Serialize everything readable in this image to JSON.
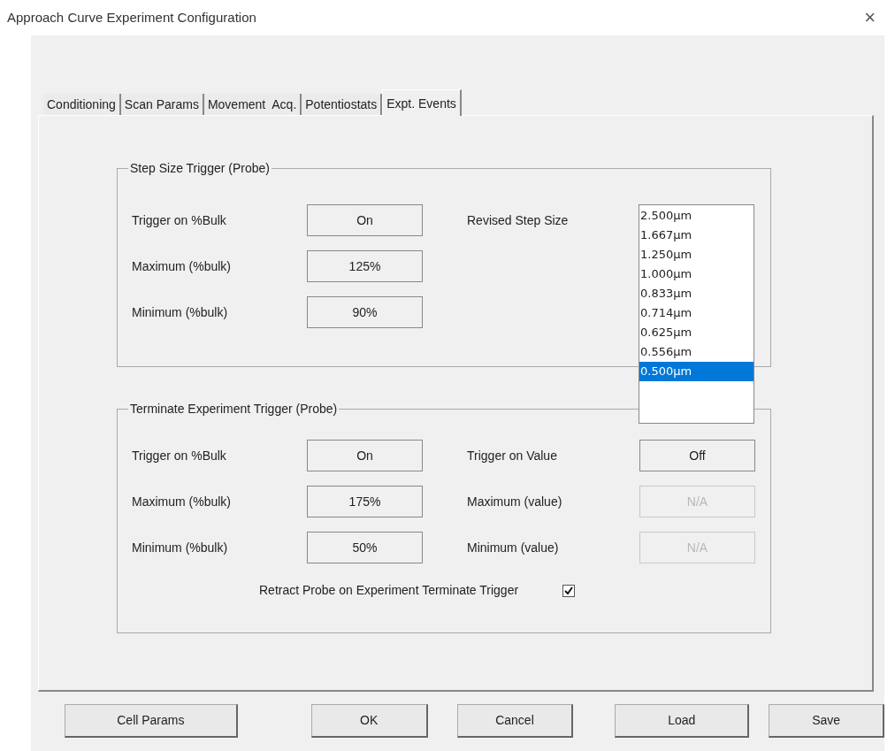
{
  "window": {
    "title": "Approach Curve Experiment Configuration",
    "close": "×"
  },
  "tabs": [
    {
      "label": "Conditioning",
      "selected": false
    },
    {
      "label": "Scan Params",
      "selected": false
    },
    {
      "label": "Movement  Acq.",
      "selected": false
    },
    {
      "label": "Potentiostats",
      "selected": false
    },
    {
      "label": "Expt. Events",
      "selected": true
    }
  ],
  "step_size_group": {
    "title": "Step Size Trigger (Probe)",
    "rows": [
      {
        "label": "Trigger on %Bulk",
        "value": "On"
      },
      {
        "label": "Maximum (%bulk)",
        "value": "125%"
      },
      {
        "label": "Minimum (%bulk)",
        "value": "90%"
      }
    ],
    "revised_step_size": {
      "label": "Revised Step Size",
      "options": [
        {
          "label": "2.500µm",
          "selected": false
        },
        {
          "label": "1.667µm",
          "selected": false
        },
        {
          "label": "1.250µm",
          "selected": false
        },
        {
          "label": "1.000µm",
          "selected": false
        },
        {
          "label": "0.833µm",
          "selected": false
        },
        {
          "label": "0.714µm",
          "selected": false
        },
        {
          "label": "0.625µm",
          "selected": false
        },
        {
          "label": "0.556µm",
          "selected": false
        },
        {
          "label": "0.500µm",
          "selected": true
        }
      ]
    }
  },
  "terminate_group": {
    "title": "Terminate Experiment Trigger (Probe)",
    "rows": [
      {
        "label": "Trigger on %Bulk",
        "value": "On",
        "label_2": "Trigger on Value",
        "value_2": "Off",
        "disabled_2": false
      },
      {
        "label": "Maximum (%bulk)",
        "value": "175%",
        "label_2": "Maximum (value)",
        "value_2": "N/A",
        "disabled_2": true
      },
      {
        "label": "Minimum (%bulk)",
        "value": "50%",
        "label_2": "Minimum (value)",
        "value_2": "N/A",
        "disabled_2": true
      }
    ],
    "retract": {
      "label": "Retract Probe on Experiment Terminate Trigger",
      "checked": true
    }
  },
  "buttons": [
    "Cell Params",
    "OK",
    "Cancel",
    "Load",
    "Save"
  ]
}
